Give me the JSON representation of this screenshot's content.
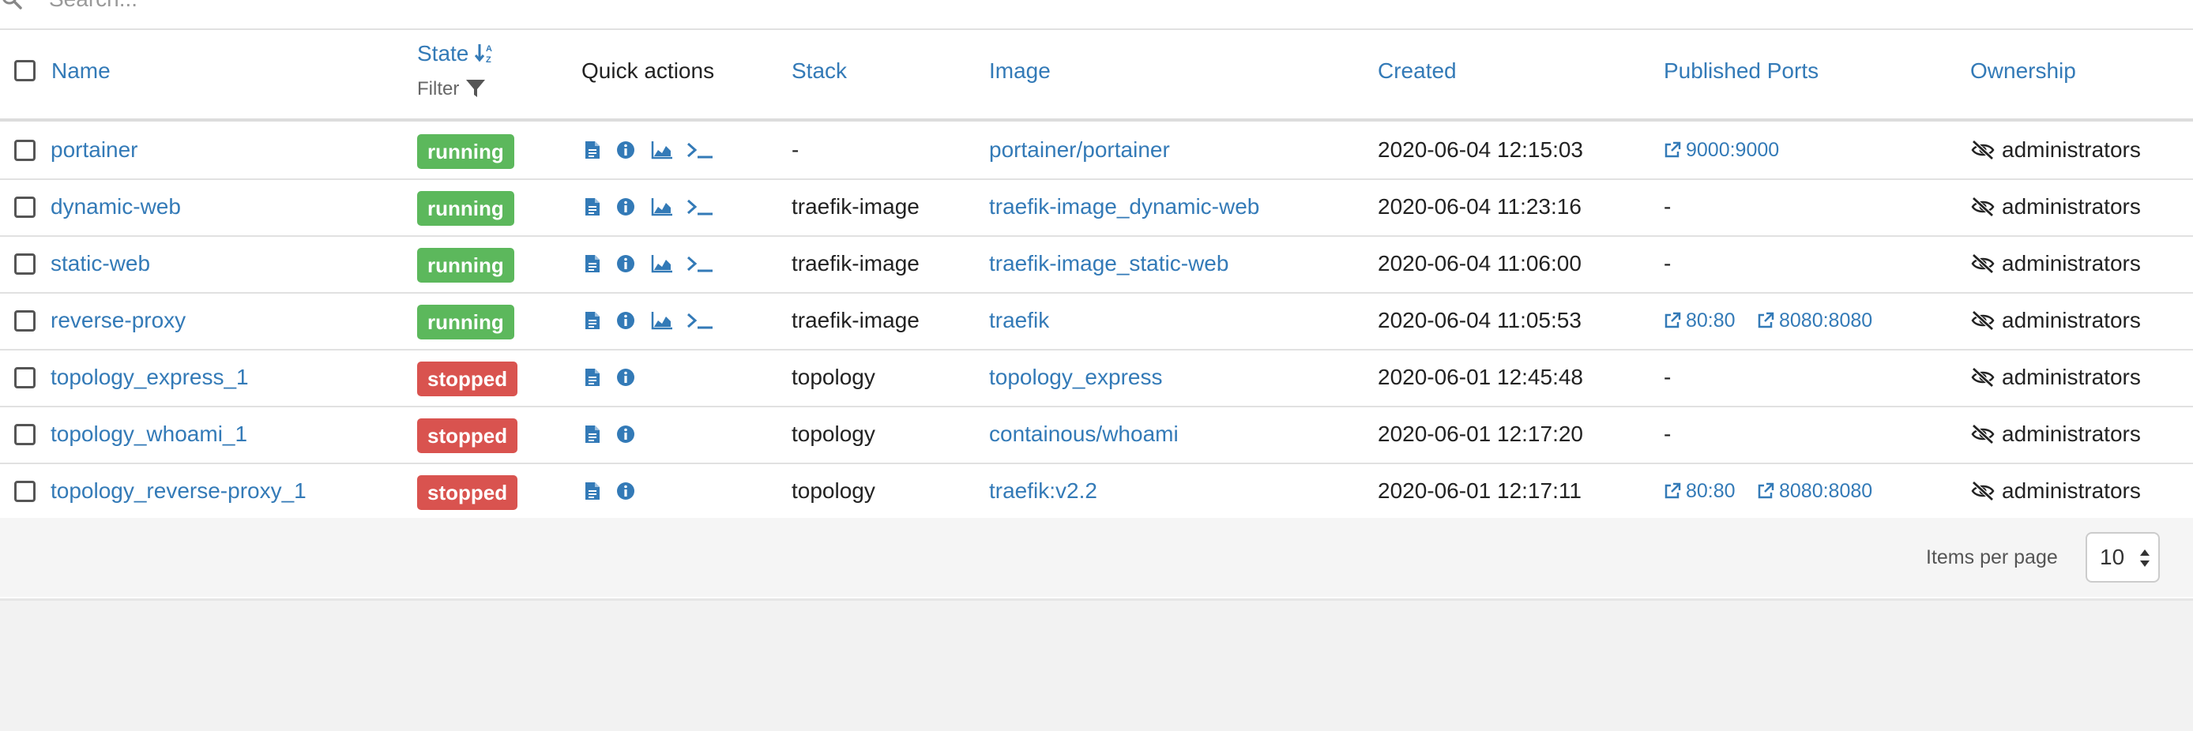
{
  "search": {
    "placeholder": "Search..."
  },
  "columns": {
    "name": "Name",
    "state": "State",
    "state_filter": "Filter",
    "quick_actions": "Quick actions",
    "stack": "Stack",
    "image": "Image",
    "created": "Created",
    "ports": "Published Ports",
    "ownership": "Ownership"
  },
  "colors": {
    "link": "#337ab7",
    "running": "#5cb85c",
    "stopped": "#d9534f"
  },
  "containers": [
    {
      "name": "portainer",
      "state": "running",
      "stack": "-",
      "image": "portainer/portainer",
      "created": "2020-06-04 12:15:03",
      "ports": [
        "9000:9000"
      ],
      "ownership": "administrators"
    },
    {
      "name": "dynamic-web",
      "state": "running",
      "stack": "traefik-image",
      "image": "traefik-image_dynamic-web",
      "created": "2020-06-04 11:23:16",
      "ports": [],
      "ownership": "administrators"
    },
    {
      "name": "static-web",
      "state": "running",
      "stack": "traefik-image",
      "image": "traefik-image_static-web",
      "created": "2020-06-04 11:06:00",
      "ports": [],
      "ownership": "administrators"
    },
    {
      "name": "reverse-proxy",
      "state": "running",
      "stack": "traefik-image",
      "image": "traefik",
      "created": "2020-06-04 11:05:53",
      "ports": [
        "80:80",
        "8080:8080"
      ],
      "ownership": "administrators"
    },
    {
      "name": "topology_express_1",
      "state": "stopped",
      "stack": "topology",
      "image": "topology_express",
      "created": "2020-06-01 12:45:48",
      "ports": [],
      "ownership": "administrators"
    },
    {
      "name": "topology_whoami_1",
      "state": "stopped",
      "stack": "topology",
      "image": "containous/whoami",
      "created": "2020-06-01 12:17:20",
      "ports": [],
      "ownership": "administrators"
    },
    {
      "name": "topology_reverse-proxy_1",
      "state": "stopped",
      "stack": "topology",
      "image": "traefik:v2.2",
      "created": "2020-06-01 12:17:11",
      "ports": [
        "80:80",
        "8080:8080"
      ],
      "ownership": "administrators"
    }
  ],
  "empty_port": "-",
  "quick_actions_icons": {
    "running": [
      "logs-icon",
      "inspect-icon",
      "stats-icon",
      "console-icon"
    ],
    "stopped": [
      "logs-icon",
      "inspect-icon"
    ]
  },
  "footer": {
    "items_per_page_label": "Items per page",
    "items_per_page_value": "10"
  }
}
